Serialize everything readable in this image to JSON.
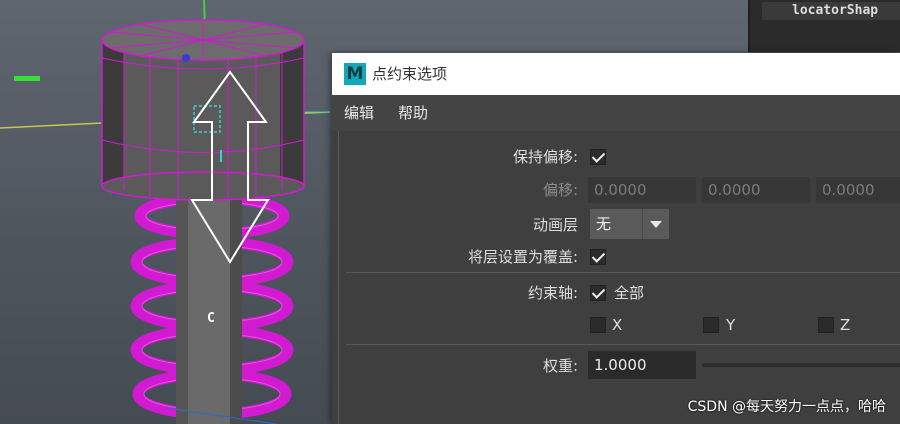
{
  "outliner": {
    "item_label": "locatorShap"
  },
  "dialog": {
    "logo_letter": "M",
    "title": "点约束选项",
    "menu": [
      "编辑",
      "帮助"
    ],
    "maintain_offset": {
      "label": "保持偏移:",
      "checked": true
    },
    "offset": {
      "label": "偏移:",
      "x": "0.0000",
      "y": "0.0000",
      "z": "0.0000"
    },
    "anim_layer": {
      "label": "动画层",
      "value": "无"
    },
    "set_layer_override": {
      "label": "将层设置为覆盖:",
      "checked": true
    },
    "constraint_axes": {
      "label": "约束轴:",
      "all_label": "全部",
      "all_checked": true,
      "x_label": "X",
      "y_label": "Y",
      "z_label": "Z",
      "x_checked": false,
      "y_checked": false,
      "z_checked": false
    },
    "weight": {
      "label": "权重:",
      "value": "1.0000"
    }
  },
  "viewport": {
    "pivot_label": "C"
  },
  "watermark": "CSDN @每天努力一点点，哈哈",
  "colors": {
    "wire": "#d21ad2",
    "ui_bg": "#444444",
    "accent": "#11a9b8"
  }
}
